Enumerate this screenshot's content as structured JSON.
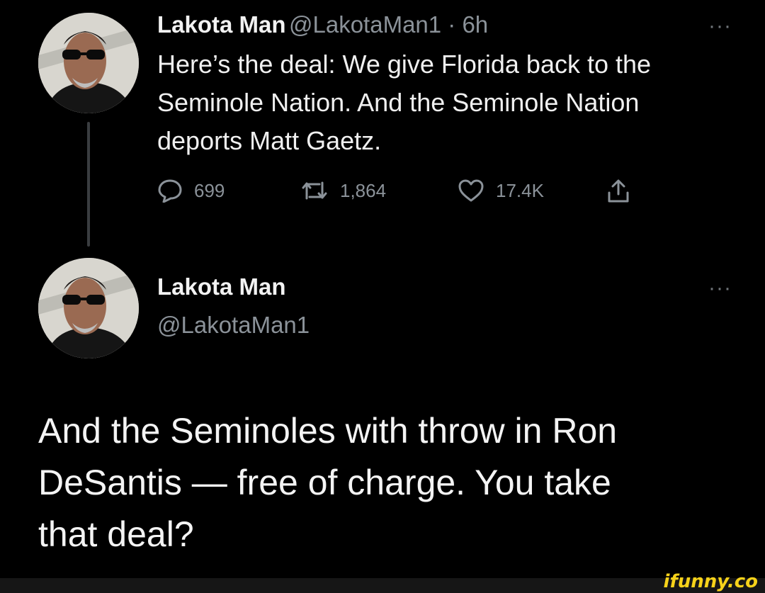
{
  "tweet1": {
    "name": "Lakota Man",
    "meta": "@LakotaMan1 · 6h",
    "text_lines": [
      "Here’s the deal: We give Florida back to the",
      "Seminole Nation. And the Seminole Nation",
      "deports Matt Gaetz."
    ],
    "more": "···",
    "replies": "699",
    "retweets": "1,864",
    "likes": "17.4K",
    "icons": {
      "reply": "reply-icon",
      "retweet": "retweet-icon",
      "like": "heart-icon",
      "share": "share-icon"
    }
  },
  "tweet2": {
    "name": "Lakota Man",
    "handle": "@LakotaMan1",
    "more": "···",
    "text_lines": [
      "And the Seminoles with throw in Ron",
      "DeSantis — free of charge. You take",
      "that deal?"
    ]
  },
  "watermark": "ifunny.co",
  "colors": {
    "background": "#000000",
    "text": "#e7e9ea",
    "secondary": "#8b9299",
    "watermark": "#f7d21a"
  }
}
